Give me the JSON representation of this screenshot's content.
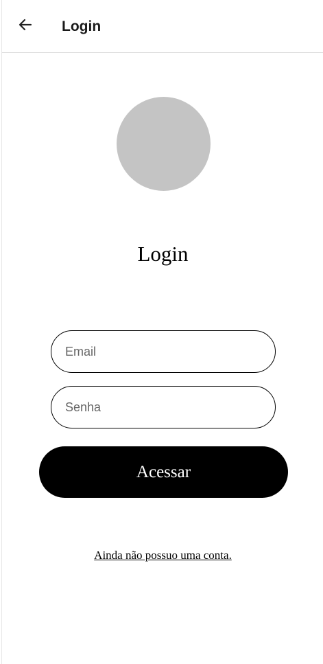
{
  "header": {
    "back_icon": "arrow-left-icon",
    "title": "Login"
  },
  "main": {
    "avatar_color": "#c4c4c4",
    "title": "Login",
    "email": {
      "placeholder": "Email",
      "value": ""
    },
    "password": {
      "placeholder": "Senha",
      "value": ""
    },
    "submit_label": "Acessar",
    "signup_link": "Ainda não possuo uma conta."
  }
}
